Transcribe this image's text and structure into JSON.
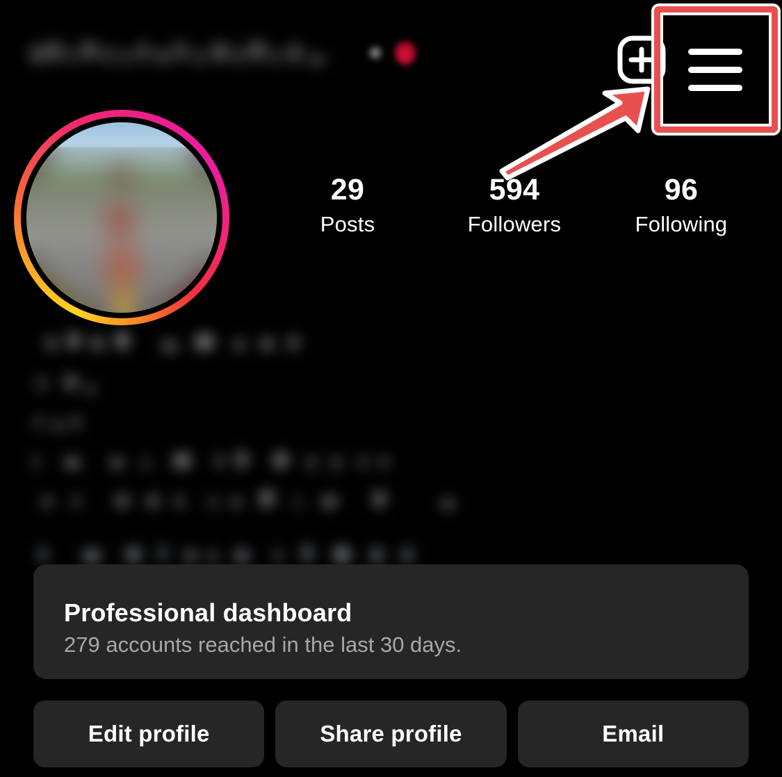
{
  "app": {
    "name": "Instagram",
    "screen": "profile",
    "background_color": "#000000",
    "card_color": "#262626"
  },
  "header": {
    "username": "",
    "username_redacted": true,
    "verified_dot": "•",
    "heart_emoji": "heart-emoji",
    "add_button_label": "+",
    "add_icon": "plus-square-icon",
    "menu_icon": "hamburger-menu-icon"
  },
  "annotation": {
    "color": "#e8504f",
    "outline_color": "#ffffff",
    "highlight_target": "hamburger-menu-icon",
    "arrow": "arrow-pointing-up-right"
  },
  "avatar": {
    "has_story_ring": true,
    "ring_colors": [
      "#ffd521",
      "#f9a825",
      "#f56040",
      "#f02a6e",
      "#ec1d8f",
      "#e91ea0"
    ],
    "image_redacted": true
  },
  "stats": [
    {
      "value": "29",
      "label": "Posts",
      "name": "posts"
    },
    {
      "value": "594",
      "label": "Followers",
      "name": "followers"
    },
    {
      "value": "96",
      "label": "Following",
      "name": "following"
    }
  ],
  "bio": {
    "redacted": true,
    "line_count": 6,
    "link_line_index": 5
  },
  "dashboard": {
    "title": "Professional dashboard",
    "subtitle": "279 accounts reached in the last 30 days.",
    "accounts_reached": "279",
    "period_days": "30"
  },
  "actions": [
    {
      "label": "Edit profile",
      "name": "edit-profile"
    },
    {
      "label": "Share profile",
      "name": "share-profile"
    },
    {
      "label": "Email",
      "name": "email"
    }
  ]
}
